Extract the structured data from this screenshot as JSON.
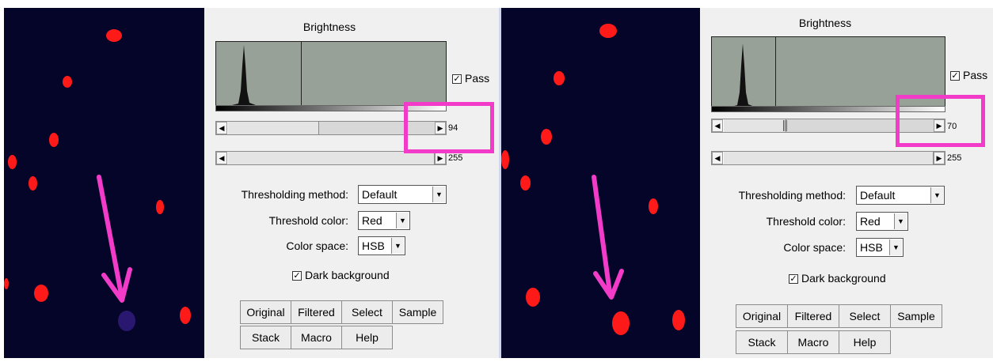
{
  "left_panel": {
    "dialog": {
      "title": "Brightness",
      "pass_label": "Pass",
      "pass_checked": "✓",
      "min_value": "94",
      "max_value": "255",
      "method_label": "Thresholding method:",
      "method_value": "Default",
      "color_label": "Threshold color:",
      "color_value": "Red",
      "space_label": "Color space:",
      "space_value": "HSB",
      "dark_bg_label": "Dark background",
      "dark_bg_checked": "✓",
      "buttons": [
        "Original",
        "Filtered",
        "Select",
        "Sample",
        "Stack",
        "Macro",
        "Help"
      ]
    }
  },
  "right_panel": {
    "dialog": {
      "title": "Brightness",
      "pass_label": "Pass",
      "pass_checked": "✓",
      "min_value": "70",
      "max_value": "255",
      "method_label": "Thresholding method:",
      "method_value": "Default",
      "color_label": "Threshold color:",
      "color_value": "Red",
      "space_label": "Color space:",
      "space_value": "HSB",
      "dark_bg_label": "Dark background",
      "dark_bg_checked": "✓",
      "buttons": [
        "Original",
        "Filtered",
        "Select",
        "Sample",
        "Stack",
        "Macro",
        "Help"
      ]
    }
  },
  "colors": {
    "highlight": "#f23cc9",
    "cell": "#ff1a1a",
    "micro_background": "#050529",
    "histogram_fill": "#98a198"
  },
  "icons": [
    "arrow-left-icon",
    "arrow-right-icon",
    "chevron-down-icon",
    "checkbox-icon",
    "annotation-arrow-icon"
  ]
}
